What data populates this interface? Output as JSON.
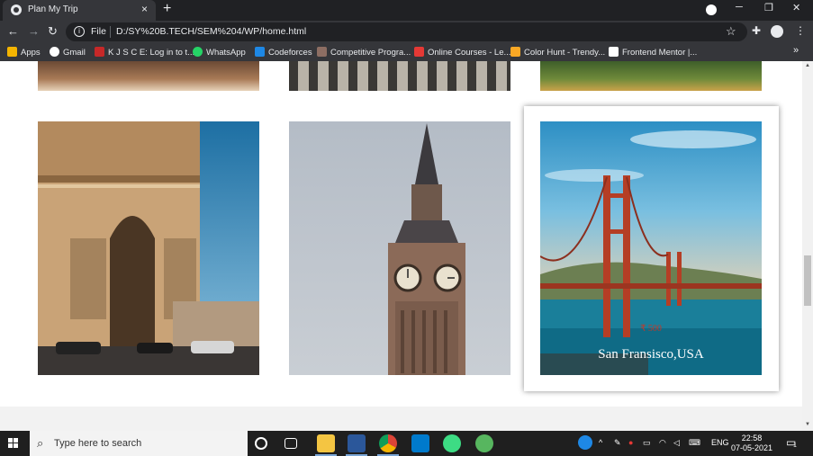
{
  "browser": {
    "tab_title": "Plan My Trip",
    "tab_close": "×",
    "new_tab": "+",
    "file_label": "File",
    "url": "D:/SY%20B.TECH/SEM%204/WP/home.html",
    "bookmarks": [
      {
        "label": "Apps",
        "color": "#f4b400"
      },
      {
        "label": "Gmail",
        "color": "#ffffff"
      },
      {
        "label": "K J S C E: Log in to t...",
        "color": "#c62828"
      },
      {
        "label": "WhatsApp",
        "color": "#25d366"
      },
      {
        "label": "Codeforces",
        "color": "#1e88e5"
      },
      {
        "label": "Competitive Progra...",
        "color": "#8d6e63"
      },
      {
        "label": "Online Courses - Le...",
        "color": "#e53935"
      },
      {
        "label": "Color Hunt - Trendy...",
        "color": "#f9a825"
      },
      {
        "label": "Frontend Mentor |...",
        "color": "#ffffff"
      }
    ],
    "bookmarks_more": "»"
  },
  "gallery": {
    "highlighted_caption": "San Fransisco,USA",
    "highlighted_price": "₹ 500"
  },
  "taskbar": {
    "search_placeholder": "Type here to search",
    "language": "ENG",
    "time": "22:58",
    "date": "07-05-2021",
    "notification_count": "1"
  }
}
